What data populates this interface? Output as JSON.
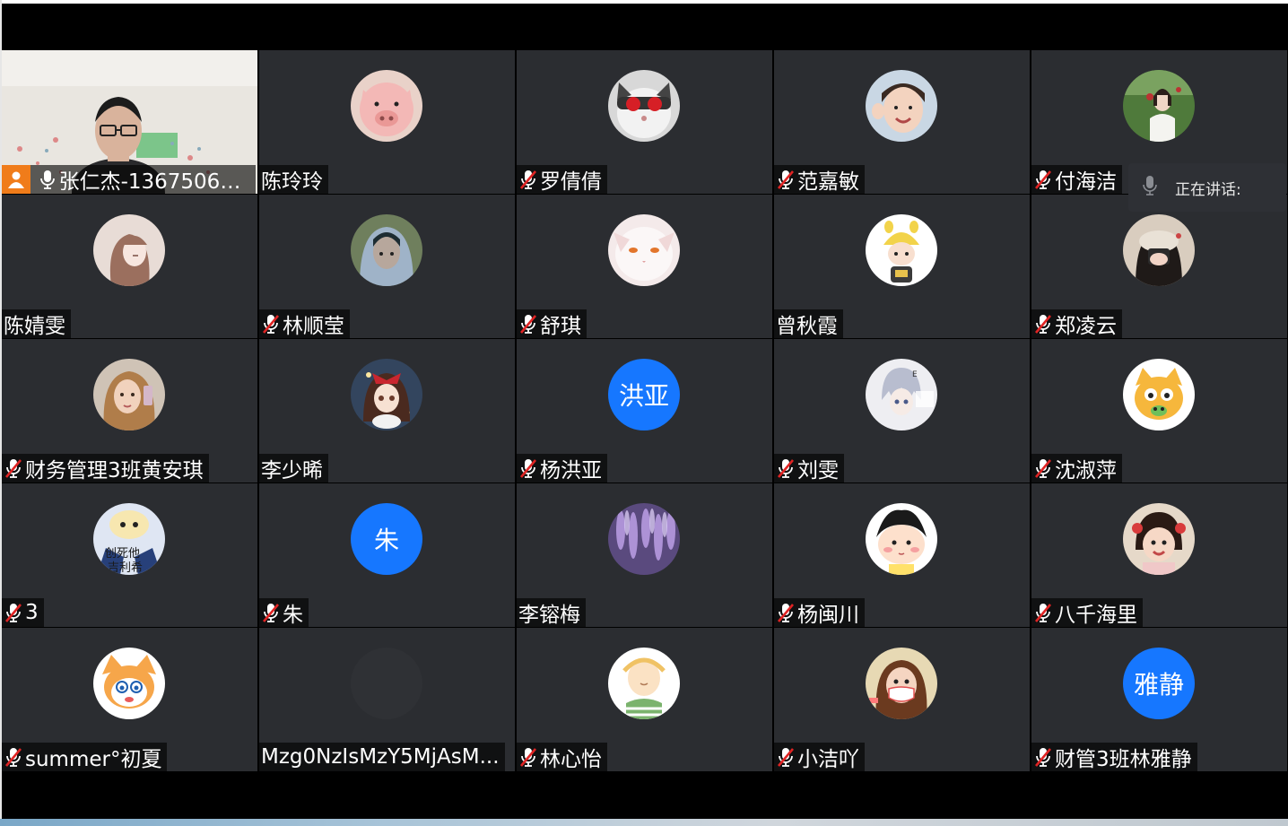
{
  "speaking_panel": {
    "label": "正在讲话:"
  },
  "participants": [
    {
      "name": "张仁杰-13675066...",
      "muted": false,
      "host": true,
      "video": true
    },
    {
      "name": "陈玲玲",
      "muted": null,
      "avatar": "pink-pig-plush"
    },
    {
      "name": "罗倩倩",
      "muted": true,
      "avatar": "cat-with-red-sunglasses"
    },
    {
      "name": "范嘉敏",
      "muted": true,
      "avatar": "smiling-girl-photo"
    },
    {
      "name": "付海洁",
      "muted": true,
      "avatar": "girl-in-field-photo"
    },
    {
      "name": "陈婧雯",
      "muted": null,
      "avatar": "anime-girl-brown-hair"
    },
    {
      "name": "林顺莹",
      "muted": true,
      "avatar": "hooded-portrait"
    },
    {
      "name": "舒琪",
      "muted": true,
      "avatar": "white-cat"
    },
    {
      "name": "曾秋霞",
      "muted": null,
      "avatar": "cartoon-kid-yellow-hat"
    },
    {
      "name": "郑凌云",
      "muted": true,
      "avatar": "girl-covering-face"
    },
    {
      "name": "财务管理3班黄安琪",
      "muted": true,
      "avatar": "blonde-girl-selfie"
    },
    {
      "name": "李少晞",
      "muted": null,
      "avatar": "anime-girl-red-bow"
    },
    {
      "name": "杨洪亚",
      "muted": true,
      "avatar_text": "洪亚"
    },
    {
      "name": "刘雯",
      "muted": true,
      "avatar": "anime-boy-silver-hair"
    },
    {
      "name": "沈淑萍",
      "muted": true,
      "avatar": "cartoon-yellow-cat"
    },
    {
      "name": "3",
      "muted": true,
      "avatar": "cartoon-meme-character",
      "avatar_caption": "创死他 吉利希"
    },
    {
      "name": "朱",
      "muted": true,
      "avatar_text": "朱"
    },
    {
      "name": "李镕梅",
      "muted": null,
      "avatar": "purple-wisteria"
    },
    {
      "name": "杨闽川",
      "muted": true,
      "avatar": "cartoon-boy-blushing"
    },
    {
      "name": "八千海里",
      "muted": true,
      "avatar": "little-girl-photo"
    },
    {
      "name": "summer°初夏",
      "muted": true,
      "avatar": "cartoon-orange-cat"
    },
    {
      "name": "Mzg0NzIsMzY5MjAsM...",
      "muted": null,
      "avatar": "dark-placeholder"
    },
    {
      "name": "林心怡",
      "muted": true,
      "avatar": "cartoon-bald-kid"
    },
    {
      "name": "小洁吖",
      "muted": true,
      "avatar": "girl-with-mask"
    },
    {
      "name": "财管3班林雅静",
      "muted": true,
      "avatar_text": "雅静"
    }
  ],
  "colors": {
    "tile": "#2b2d31",
    "text_avatar": "#1677ff",
    "host_badge": "#f07c1a"
  }
}
